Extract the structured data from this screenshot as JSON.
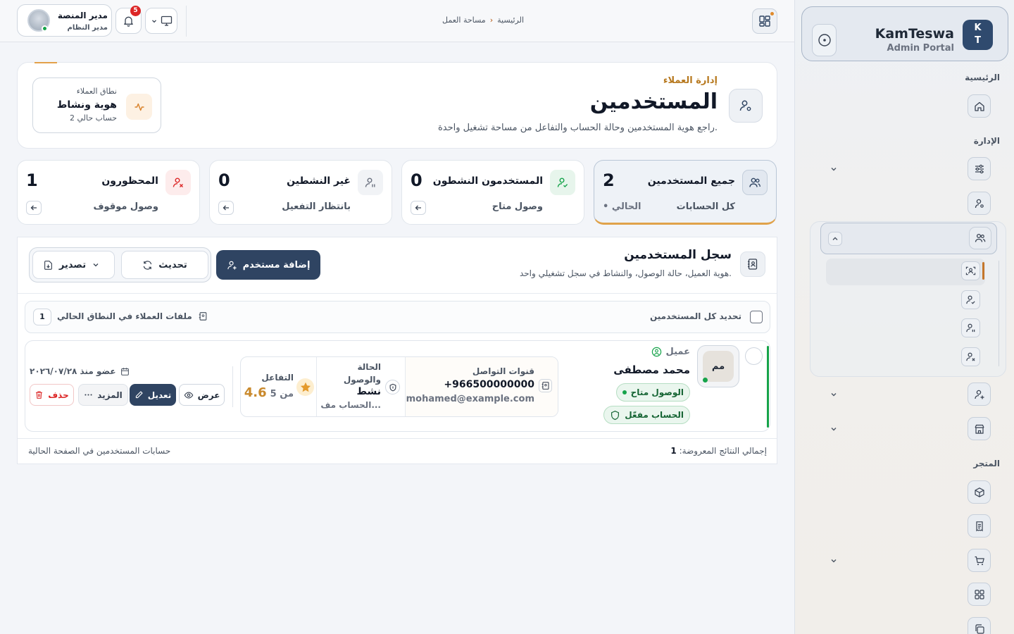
{
  "brand": {
    "logo_line1": "K",
    "logo_line2": "T",
    "name": "KamTeswa",
    "subtitle": "Admin Portal"
  },
  "sidebar": {
    "sections": {
      "home": "الرئيسية",
      "admin": "الإدارة",
      "store": "المتجر"
    }
  },
  "topbar": {
    "breadcrumb": {
      "home": "الرئيسية",
      "separator": "‹",
      "current": "مساحة العمل"
    },
    "user": {
      "name": "مدير المنصة",
      "role": "مدير النظام"
    },
    "notifications_count": "5"
  },
  "hero": {
    "kicker": "إدارة العملاء",
    "title": "المستخدمين",
    "description": "راجع هوية المستخدمين وحالة الحساب والتفاعل من مساحة تشغيل واحدة.",
    "scope": {
      "label": "نطاق العملاء",
      "value": "هوية ونشاط",
      "count": "2 حساب حالي"
    }
  },
  "stats": [
    {
      "title": "جميع المستخدمين",
      "value": "2",
      "subtitle": "كل الحسابات",
      "current": "• الحالي"
    },
    {
      "title": "المستخدمون النشطون",
      "value": "0",
      "subtitle": "وصول متاح"
    },
    {
      "title": "غير النشطين",
      "value": "0",
      "subtitle": "بانتظار التفعيل"
    },
    {
      "title": "المحظورون",
      "value": "1",
      "subtitle": "وصول موقوف"
    }
  ],
  "registry": {
    "title": "سجل المستخدمين",
    "description": "هوية العميل، حالة الوصول، والنشاط في سجل تشغيلي واحد.",
    "add_label": "إضافة مستخدم",
    "refresh_label": "تحديث",
    "export_label": "تصدير",
    "select_all_label": "تحديد كل المستخدمين",
    "scope_files_label": "ملفات العملاء في النطاق الحالي",
    "scope_files_count": "1",
    "users": [
      {
        "initials": "مم",
        "role": "عميل",
        "name": "محمد مصطفى",
        "access_badge": "الوصول متاح",
        "account_badge": "الحساب مفعّل",
        "contact_label": "قنوات التواصل",
        "phone": "+966500000000",
        "email": "mohamed@example.com",
        "status_label": "الحالة والوصول",
        "status_value": "نشط",
        "status_sub": "الحساب مف...",
        "engagement_label": "التفاعل",
        "engagement_value": "4.6",
        "engagement_suffix": "من 5",
        "member_since": "عضو منذ ٢٠٢٦/٠٧/٢٨",
        "actions": {
          "view": "عرض",
          "edit": "تعديل",
          "more": "المزيد",
          "delete": "حذف"
        }
      }
    ],
    "footer": {
      "total_label": "إجمالي النتائج المعروضة:",
      "total_value": "1",
      "note": "حسابات المستخدمين في الصفحة الحالية"
    }
  },
  "colors": {
    "primary": "#2f4462",
    "accent": "#e0a24a",
    "success": "#16a34a",
    "danger": "#dc2626",
    "brand": "#2f4a6e"
  }
}
